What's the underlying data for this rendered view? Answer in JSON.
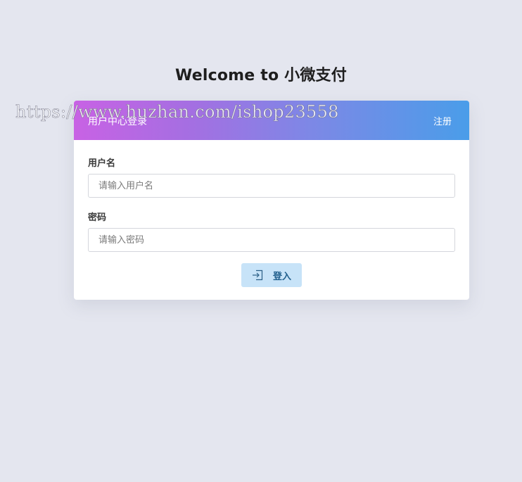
{
  "page": {
    "title": "Welcome to 小微支付"
  },
  "card": {
    "title": "用户中心登录",
    "register_label": "注册"
  },
  "form": {
    "username": {
      "label": "用户名",
      "placeholder": "请输入用户名",
      "value": ""
    },
    "password": {
      "label": "密码",
      "placeholder": "请输入密码",
      "value": ""
    },
    "login_button_label": "登入",
    "login_icon": "sign-in-icon"
  },
  "watermark": {
    "text": "https://www.huzhan.com/ishop23558"
  },
  "colors": {
    "background": "#e4e6ef",
    "header_gradient_start": "#c862e4",
    "header_gradient_end": "#4a9de9",
    "button_bg": "#c7e3f8",
    "button_text": "#1f5e8c"
  }
}
